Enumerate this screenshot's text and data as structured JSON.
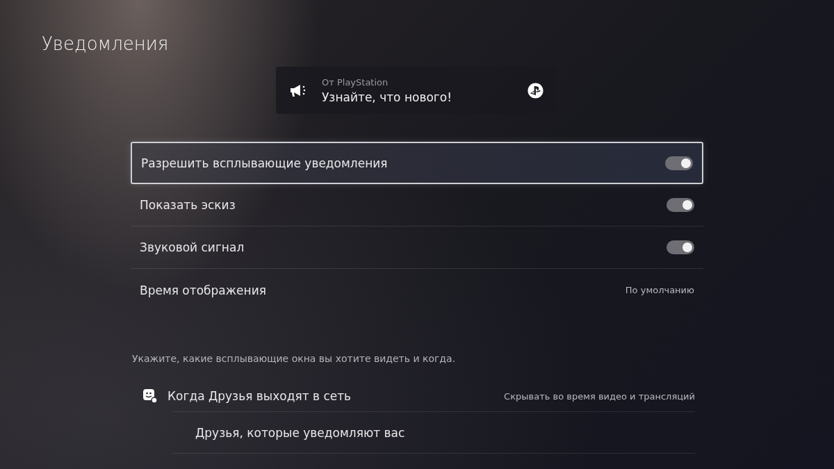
{
  "title": "Уведомления",
  "preview": {
    "source": "От PlayStation",
    "message": "Узнайте, что нового!"
  },
  "settings": [
    {
      "kind": "toggle",
      "label": "Разрешить всплывающие уведомления",
      "on": true,
      "selected": true
    },
    {
      "kind": "toggle",
      "label": "Показать эскиз",
      "on": true,
      "selected": false
    },
    {
      "kind": "toggle",
      "label": "Звуковой сигнал",
      "on": true,
      "selected": false
    },
    {
      "kind": "value",
      "label": "Время отображения",
      "value": "По умолчанию",
      "selected": false
    }
  ],
  "hint": "Укажите, какие всплывающие окна вы хотите видеть и когда.",
  "popups": [
    {
      "label": "Когда Друзья выходят в сеть",
      "value": "Скрывать во время видео и трансляций",
      "children": [
        {
          "label": "Друзья, которые уведомляют вас"
        }
      ]
    }
  ]
}
